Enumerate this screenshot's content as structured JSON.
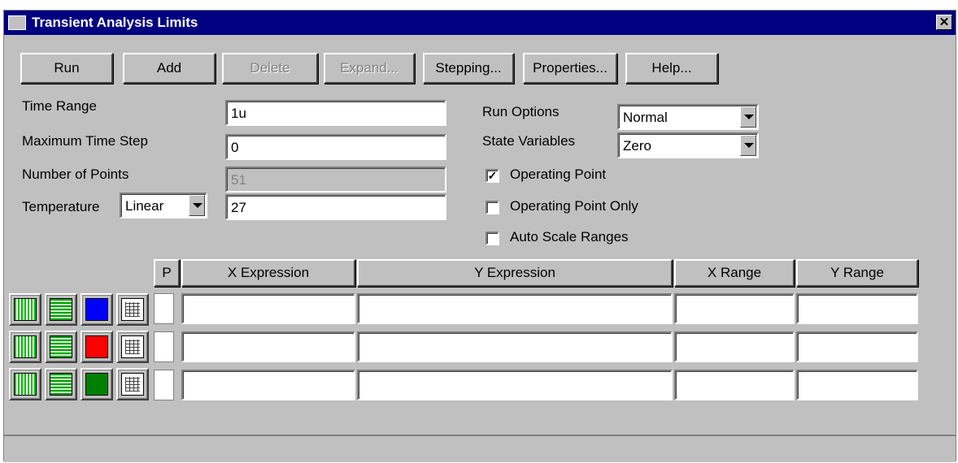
{
  "window": {
    "title": "Transient Analysis Limits",
    "close_label": "✕"
  },
  "toolbar": {
    "buttons": [
      {
        "label": "Run",
        "enabled": true
      },
      {
        "label": "Add",
        "enabled": true
      },
      {
        "label": "Delete",
        "enabled": false
      },
      {
        "label": "Expand...",
        "enabled": false
      },
      {
        "label": "Stepping...",
        "enabled": true
      },
      {
        "label": "Properties...",
        "enabled": true
      },
      {
        "label": "Help...",
        "enabled": true
      }
    ]
  },
  "limits": {
    "time_range": {
      "label": "Time Range",
      "value": "1u"
    },
    "max_time_step": {
      "label": "Maximum Time Step",
      "value": "0"
    },
    "num_points": {
      "label": "Number of Points",
      "value": "51"
    },
    "temperature": {
      "label": "Temperature",
      "mode": "Linear",
      "value": "27"
    }
  },
  "options": {
    "run_options": {
      "label": "Run Options",
      "value": "Normal"
    },
    "state_variables": {
      "label": "State Variables",
      "value": "Zero"
    },
    "checkboxes": [
      {
        "label": "Operating Point",
        "checked": true
      },
      {
        "label": "Operating Point Only",
        "checked": false
      },
      {
        "label": "Auto Scale Ranges",
        "checked": false
      }
    ]
  },
  "table": {
    "columns": [
      "P",
      "X Expression",
      "Y Expression",
      "X Range",
      "Y Range"
    ],
    "rows": [
      {
        "color": "#0000ff",
        "p": "",
        "x_expr": "",
        "y_expr": "",
        "x_range": "",
        "y_range": ""
      },
      {
        "color": "#ff0000",
        "p": "",
        "x_expr": "",
        "y_expr": "",
        "x_range": "",
        "y_range": ""
      },
      {
        "color": "#008000",
        "p": "",
        "x_expr": "",
        "y_expr": "",
        "x_range": "",
        "y_range": ""
      }
    ],
    "icons": [
      "vertical-grid-icon",
      "horizontal-grid-icon",
      "plot-color-icon",
      "plot-grid-icon"
    ]
  }
}
